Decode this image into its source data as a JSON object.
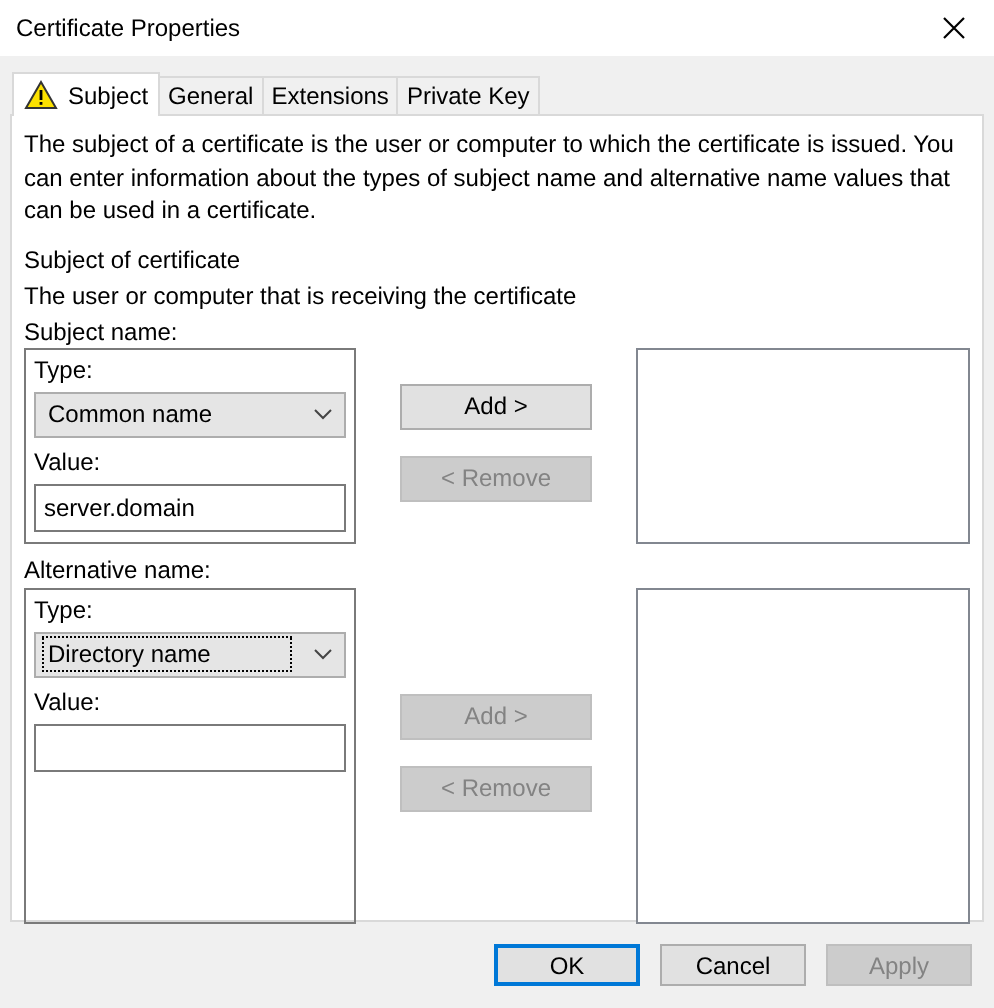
{
  "window": {
    "title": "Certificate Properties"
  },
  "tabs": [
    {
      "label": "Subject",
      "selected": true,
      "warning": true
    },
    {
      "label": "General",
      "selected": false,
      "warning": false
    },
    {
      "label": "Extensions",
      "selected": false,
      "warning": false
    },
    {
      "label": "Private Key",
      "selected": false,
      "warning": false
    }
  ],
  "description": "The subject of a certificate is the user or computer to which the certificate is issued. You can enter information about the types of subject name and alternative name values that can be used in a certificate.",
  "section_title": "Subject of certificate",
  "section_hint": "The user or computer that is receiving the certificate",
  "groups": [
    {
      "label": "Subject name:",
      "type_field": {
        "label": "Type:",
        "value": "Common name",
        "focused": false
      },
      "value_field": {
        "label": "Value:",
        "value": "server.domain"
      },
      "add_button": {
        "label": "Add >",
        "disabled": false
      },
      "remove_button": {
        "label": "< Remove",
        "disabled": true
      }
    },
    {
      "label": "Alternative name:",
      "type_field": {
        "label": "Type:",
        "value": "Directory name",
        "focused": true
      },
      "value_field": {
        "label": "Value:"
      },
      "add_button": {
        "label": "Add >",
        "disabled": true
      },
      "remove_button": {
        "label": "< Remove",
        "disabled": true
      }
    }
  ],
  "buttons": [
    {
      "label": "OK",
      "default": true,
      "disabled": false
    },
    {
      "label": "Cancel",
      "default": false,
      "disabled": false
    },
    {
      "label": "Apply",
      "default": false,
      "disabled": true
    }
  ]
}
